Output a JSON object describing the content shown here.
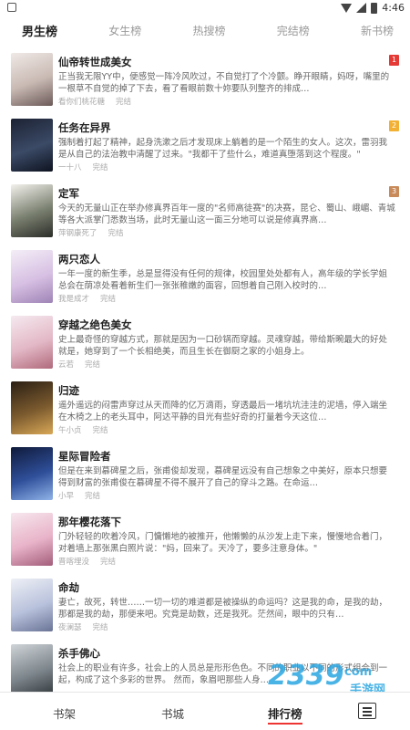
{
  "status_bar": {
    "time": "4:46"
  },
  "tabs": [
    {
      "label": "男生榜",
      "active": true
    },
    {
      "label": "女生榜",
      "active": false
    },
    {
      "label": "热搜榜",
      "active": false
    },
    {
      "label": "完结榜",
      "active": false
    },
    {
      "label": "新书榜",
      "active": false
    }
  ],
  "books": [
    {
      "title": "仙帝转世成美女",
      "desc": "正当我无限YY中，便感觉一阵冷风吹过，不自觉打了个冷颤。睁开眼睛，妈呀，嘴里的一根草不自觉的掉了下去，看了看眼前数十妳要队列整齐的排成…",
      "author": "看你们桃花糖",
      "status": "完结",
      "rank": "1",
      "rank_color": "#e53935",
      "cover": [
        "#efe9e6",
        "#c9b9b3",
        "#6b5a58"
      ]
    },
    {
      "title": "任务在异界",
      "desc": "强制着打起了精神，起身洗漱之后才发现床上躺着的是一个陌生的女人。这次，雷羽我是从自己的法治教中清醒了过来。\"我都干了些什么，难道真堕落到这个程度。\"",
      "author": "一十八",
      "status": "完结",
      "rank": "2",
      "rank_color": "#f2b134",
      "cover": [
        "#1c2233",
        "#3b4a66",
        "#0e1320"
      ]
    },
    {
      "title": "定军",
      "desc": "今天的无量山正在举办修真界百年一度的\"名师高徒赛\"的决赛，昆仑、蜀山、峨嵋、青城等各大派掌门悉数当场，此时无量山这一面三分地可以说是修真界高…",
      "author": "萍钢康死了",
      "status": "完结",
      "rank": "3",
      "rank_color": "#c98a5a",
      "cover": [
        "#f3f1ec",
        "#7a8070",
        "#2b2d28"
      ]
    },
    {
      "title": "两只恋人",
      "desc": "一年一度的新生季，总是显得没有任何的规律，校园里处处都有人，高年级的学长学姐总会在荫凉处看着新生们一张张稚嫩的面容，回想着自己刚入校时的…",
      "author": "我是成才",
      "status": "完结",
      "rank": "",
      "rank_color": "",
      "cover": [
        "#f4eef7",
        "#d7c0e3",
        "#9e84b6"
      ]
    },
    {
      "title": "穿越之绝色美女",
      "desc": "史上最奇怪的穿越方式，那就是因为一口砂锅而穿越。灵魂穿越，带给斯畹最大的好处就是，她穿到了一个长相绝美，而且生长在御厨之家的小姐身上。",
      "author": "云若",
      "status": "完结",
      "rank": "",
      "rank_color": "",
      "cover": [
        "#f5e9ef",
        "#e3b8c6",
        "#b06a7c"
      ]
    },
    {
      "title": "归迹",
      "desc": "遥外遥远的闷雷声穿过从天而降的亿万滴雨，穿透最后一堵坑坑洼洼的泥墙，停入端坐在木椅之上的老头耳中，阿达平静的目光有些好奇的打量着今天这位…",
      "author": "午小贞",
      "status": "完结",
      "rank": "",
      "rank_color": "",
      "cover": [
        "#2a1f14",
        "#7b5a2e",
        "#d9a857"
      ]
    },
    {
      "title": "星际冒险者",
      "desc": "但是在来到慕碑星之后，张甫俊却发现，慕碑星远没有自己想象之中美好，原本只想要得到财富的张甫俊在慕碑星不得不展开了自己的穿斗之路。在命运…",
      "author": "小早",
      "status": "完结",
      "rank": "",
      "rank_color": "",
      "cover": [
        "#0f1a3a",
        "#2f4f9a",
        "#8fb3e8"
      ]
    },
    {
      "title": "那年樱花落下",
      "desc": "门外轻轻的吹着冷风，门慵懒地的被推开，他懒懒的从沙发上走下来，慢慢地合着门，对着墙上那张黑白照片说：\"妈，回来了。天冷了，要多注意身体。\"",
      "author": "晋喀埋没",
      "status": "完结",
      "rank": "",
      "rank_color": "",
      "cover": [
        "#f7e7ee",
        "#e8b3c8",
        "#a35d7a"
      ]
    },
    {
      "title": "命劫",
      "desc": "妻亡，故死，转世……一切一切的难道都是被操纵的命运吗？这是我的命，是我的劫，那都是我的劫，那便来吧。究竟是劫数，还是我死。茫然间，眼中的只有…",
      "author": "夜澜瑟",
      "status": "完结",
      "rank": "",
      "rank_color": "",
      "cover": [
        "#eef0f6",
        "#b9c2dc",
        "#6a7496"
      ]
    },
    {
      "title": "杀手佛心",
      "desc": "社会上的职业有许多，社会上的人员总是形形色色。不同的职业以不同的形式组合到一起，构成了这个多彩的世界。 然而，象眉吧那些人身…",
      "author": "",
      "status": "",
      "rank": "",
      "rank_color": "",
      "cover": [
        "#cfd4d8",
        "#7d868c",
        "#2e3438"
      ]
    }
  ],
  "bottom_nav": [
    {
      "label": "书架",
      "active": false
    },
    {
      "label": "书城",
      "active": false
    },
    {
      "label": "排行榜",
      "active": true
    }
  ],
  "watermark": {
    "main": "2339",
    "suffix": "com",
    "sub": "手游网"
  },
  "colors": {
    "accent": "#e53935",
    "watermark": "#2aa6e0",
    "rank1": "#e53935",
    "rank2": "#f2b134",
    "rank3": "#c98a5a"
  }
}
